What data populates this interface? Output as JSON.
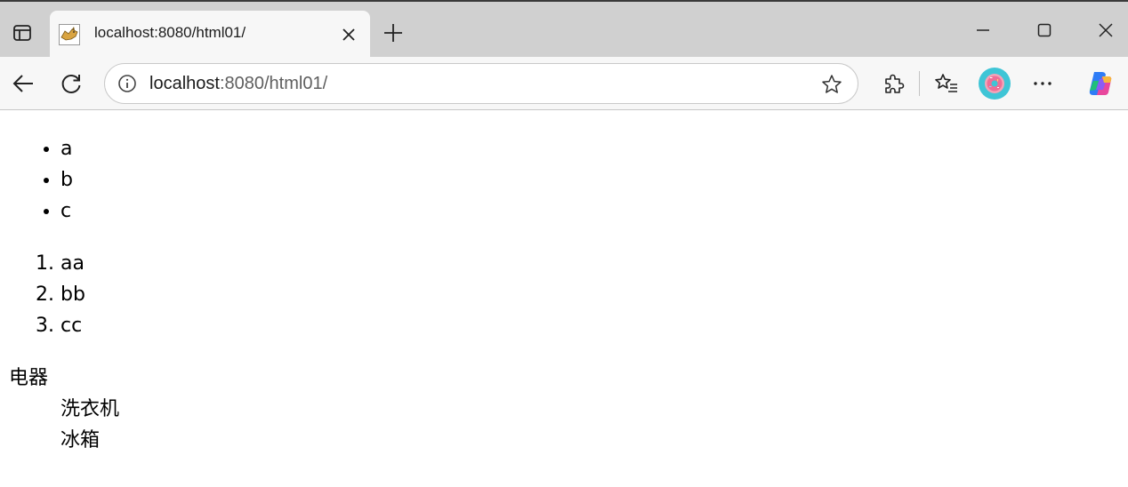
{
  "tab": {
    "title": "localhost:8080/html01/",
    "favicon": "tomcat-favicon"
  },
  "address_bar": {
    "url_host": "localhost",
    "url_rest": ":8080/html01/"
  },
  "icons": {
    "tab_actions": "tab-actions-icon",
    "close": "close-icon",
    "new_tab": "plus-icon",
    "minimize": "minimize-icon",
    "maximize": "maximize-icon",
    "window_close": "close-icon",
    "back": "back-arrow-icon",
    "refresh": "refresh-icon",
    "site_info": "info-icon",
    "favorite": "star-icon",
    "extensions": "puzzle-icon",
    "favorites": "favorites-list-icon",
    "profile": "donut-avatar-icon",
    "more": "ellipsis-icon",
    "copilot": "copilot-icon"
  },
  "colors": {
    "tabstrip": "#d0d0d0",
    "toolbar": "#f7f7f7",
    "avatar": "#3fc5d6"
  },
  "page": {
    "unordered": [
      "a",
      "b",
      "c"
    ],
    "ordered": [
      "aa",
      "bb",
      "cc"
    ],
    "definition": {
      "term": "电器",
      "items": [
        "洗衣机",
        "冰箱"
      ]
    }
  }
}
